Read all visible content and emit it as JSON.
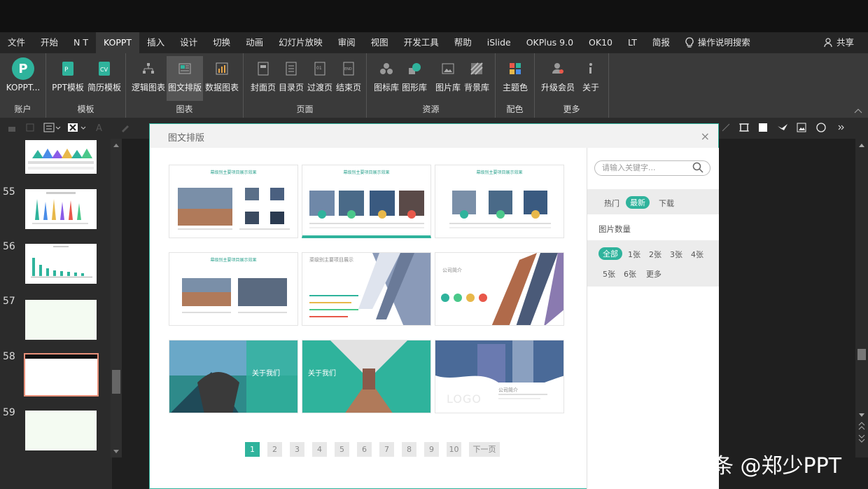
{
  "tabs": [
    "文件",
    "开始",
    "N T",
    "KOPPT",
    "插入",
    "设计",
    "切换",
    "动画",
    "幻灯片放映",
    "审阅",
    "视图",
    "开发工具",
    "帮助",
    "iSlide",
    "OKPlus 9.0",
    "OK10",
    "LT",
    "简报"
  ],
  "active_tab": "KOPPT",
  "search_label": "操作说明搜索",
  "share_label": "共享",
  "ribbon": {
    "account": {
      "btn": "KOPPT...",
      "label": "账户"
    },
    "template": {
      "btns": [
        "PPT模板",
        "简历模板"
      ],
      "label": "模板"
    },
    "chart": {
      "btns": [
        "逻辑图表",
        "图文排版",
        "数据图表"
      ],
      "label": "图表"
    },
    "page": {
      "btns": [
        "封面页",
        "目录页",
        "过渡页",
        "结束页"
      ],
      "label": "页面"
    },
    "resource": {
      "btns": [
        "图标库",
        "图形库",
        "图片库",
        "背景库"
      ],
      "label": "资源"
    },
    "color": {
      "btns": [
        "主题色"
      ],
      "label": "配色"
    },
    "more": {
      "btns": [
        "升级会员",
        "关于"
      ],
      "label": "更多"
    }
  },
  "slides": {
    "numbers": [
      "55",
      "56",
      "57",
      "58",
      "59"
    ]
  },
  "modal": {
    "title": "图文排版",
    "close": "×",
    "card_titles": [
      "幕级别主要项目展示效果",
      "幕级别主要项目展示效果",
      "幕级别主要项目展示效果",
      "幕级别主要项目展示效果",
      "菜级别主要项目展示",
      "公司简介",
      "关于我们",
      "关于我们",
      "公司简介"
    ],
    "card_extra": {
      "logo": "LOGO"
    },
    "pages": [
      "1",
      "2",
      "3",
      "4",
      "5",
      "6",
      "7",
      "8",
      "9",
      "10"
    ],
    "next_page": "下一页",
    "side": {
      "search_placeholder": "请输入关键字...",
      "sort": [
        "热门",
        "最新",
        "下载"
      ],
      "sort_active": "最新",
      "count_label": "图片数量",
      "counts_row1": [
        "全部",
        "1张",
        "2张",
        "3张",
        "4张"
      ],
      "counts_row2": [
        "5张",
        "6张",
        "更多"
      ],
      "count_active": "全部"
    }
  },
  "watermark": "头条 @郑少PPT",
  "colors": {
    "accent": "#2fb39c",
    "ribbon": "#3a3a3a"
  }
}
